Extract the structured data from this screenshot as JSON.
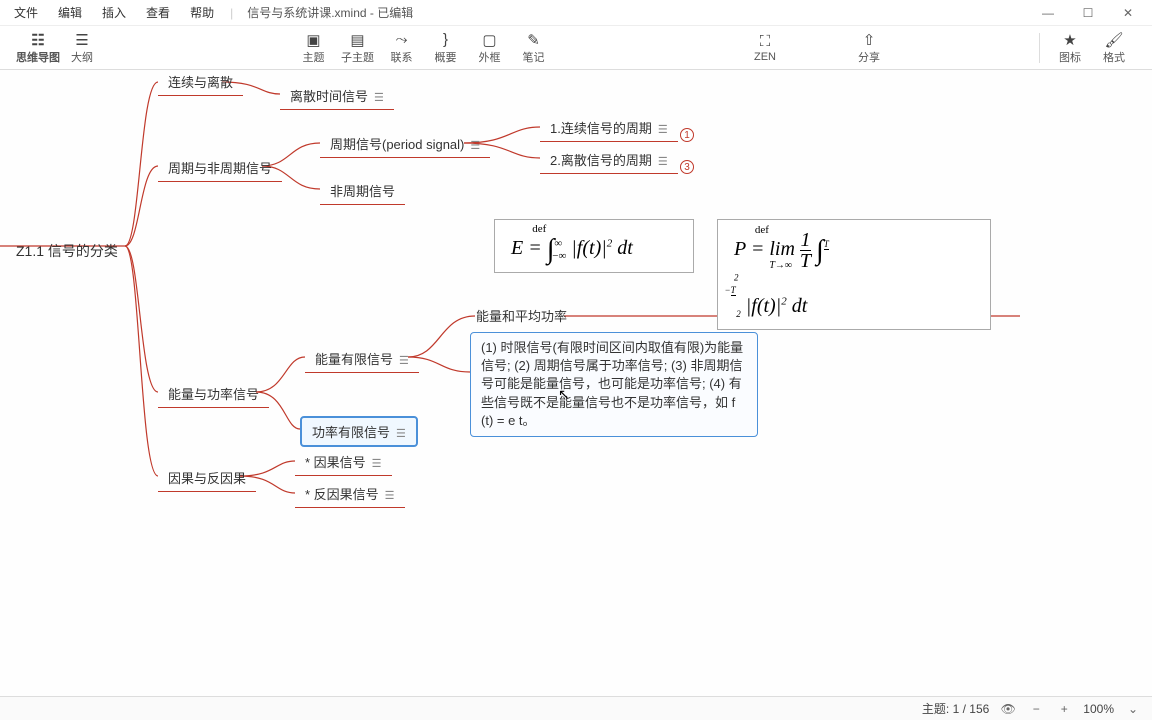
{
  "menu": {
    "file": "文件",
    "edit": "编辑",
    "insert": "插入",
    "view": "查看",
    "help": "帮助"
  },
  "title": "信号与系统讲课.xmind - 已编辑",
  "winControls": {
    "min": "—",
    "max": "☐",
    "close": "✕"
  },
  "toolbar": {
    "view1": "思维导图",
    "view2": "大纲",
    "topic": "主题",
    "subtopic": "子主题",
    "relation": "联系",
    "summary": "概要",
    "boundary": "外框",
    "note": "笔记",
    "zen": "ZEN",
    "share": "分享",
    "icon": "图标",
    "format": "格式"
  },
  "nodes": {
    "root": "Z1.1 信号的分类",
    "c1": "连续与离散",
    "c1a": "离散时间信号",
    "c2": "周期与非周期信号",
    "c2a": "周期信号(period signal)",
    "c2b": "非周期信号",
    "c2a1": "1.连续信号的周期",
    "c2a2": "2.离散信号的周期",
    "c3": "能量与功率信号",
    "c3a": "能量有限信号",
    "c3b": "功率有限信号",
    "c4": "因果与反因果",
    "c4a": "* 因果信号",
    "c4b": "* 反因果信号"
  },
  "badges": {
    "b1": "1",
    "b2": "3"
  },
  "formulas": {
    "energy": "E = ∫ |f(t)|² dt",
    "power": "P = lim (1/T) ∫ |f(t)|² dt",
    "def": "def",
    "inf": "∞",
    "ninf": "−∞",
    "T2a": "T/2",
    "T2b": "−T/2",
    "Tinf": "T→∞"
  },
  "noteTitle": "能量和平均功率",
  "noteBody": "(1) 时限信号(有限时间区间内取值有限)为能量信号; (2) 周期信号属于功率信号; (3) 非周期信号可能是能量信号，也可能是功率信号; (4) 有些信号既不是能量信号也不是功率信号，如 f (t) = e t。",
  "status": {
    "topics": "主题: 1 / 156",
    "zoom": "100%"
  }
}
